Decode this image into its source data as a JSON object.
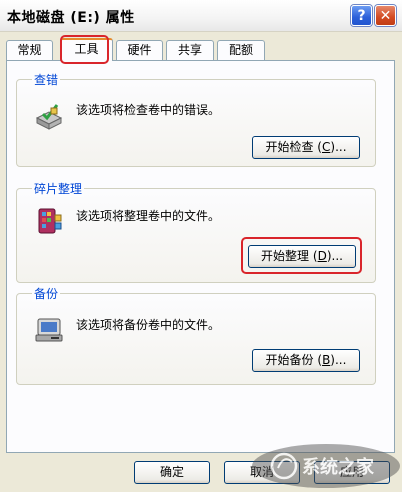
{
  "window": {
    "title": "本地磁盘 (E:) 属性",
    "help_glyph": "?",
    "close_glyph": "✕"
  },
  "tabs": [
    {
      "label": "常规",
      "active": false
    },
    {
      "label": "工具",
      "active": true
    },
    {
      "label": "硬件",
      "active": false
    },
    {
      "label": "共享",
      "active": false
    },
    {
      "label": "配额",
      "active": false
    }
  ],
  "sections": {
    "check": {
      "label": "查错",
      "description": "该选项将检查卷中的错误。",
      "button_text": "开始检查",
      "button_accel": "C",
      "button_suffix": "...",
      "icon": "check-disk-icon"
    },
    "defrag": {
      "label": "碎片整理",
      "description": "该选项将整理卷中的文件。",
      "button_text": "开始整理",
      "button_accel": "D",
      "button_suffix": "...",
      "icon": "defrag-icon"
    },
    "backup": {
      "label": "备份",
      "description": "该选项将备份卷中的文件。",
      "button_text": "开始备份",
      "button_accel": "B",
      "button_suffix": "...",
      "icon": "backup-icon"
    }
  },
  "footer": {
    "ok": "确定",
    "cancel": "取消",
    "apply": "应用"
  },
  "watermark": {
    "text": "系统之家"
  },
  "colors": {
    "highlight": "#d9252b",
    "group_label": "#0046d5"
  }
}
